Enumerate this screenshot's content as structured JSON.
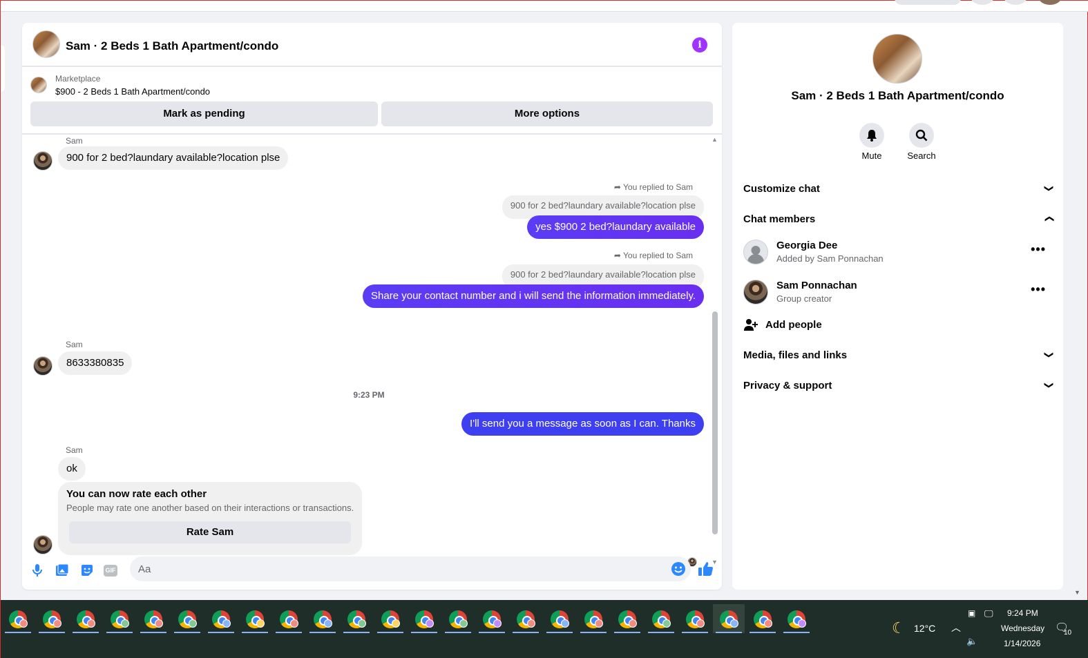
{
  "chat": {
    "title": "Sam · 2 Beds 1 Bath Apartment/condo",
    "info_icon": "info-icon",
    "marketplace_label": "Marketplace",
    "marketplace_item": "$900 - 2 Beds 1 Bath Apartment/condo",
    "mark_pending_label": "Mark as pending",
    "more_options_label": "More options"
  },
  "messages": {
    "m1_sender": "Sam",
    "m1_text": "900 for 2 bed?laundary available?location plse",
    "m2_reply_note": "You replied to Sam",
    "m2_quote": "900 for 2 bed?laundary available?location plse",
    "m2_text": "yes $900 2 bed?laundary available",
    "m3_reply_note": "You replied to Sam",
    "m3_quote": "900 for 2 bed?laundary available?location plse",
    "m3_text": "Share your contact number and i will send the information immediately.",
    "m4_sender": "Sam",
    "m4_text": "8633380835",
    "timestamp": "9:23 PM",
    "m5_text": "I'll send you a message as soon as I can. Thanks",
    "m6_sender": "Sam",
    "m6_text": "ok",
    "rate_title": "You can now rate each other",
    "rate_sub": "People may rate one another based on their interactions or transactions.",
    "rate_button": "Rate Sam"
  },
  "composer": {
    "placeholder": "Aa",
    "icons": [
      "microphone-icon",
      "photo-icon",
      "sticker-icon",
      "gif-icon",
      "emoji-icon",
      "thumbs-up-icon"
    ],
    "gif_label": "GIF"
  },
  "info_panel": {
    "name": "Sam · 2 Beds 1 Bath Apartment/condo",
    "mute_label": "Mute",
    "search_label": "Search",
    "customize_chat": "Customize chat",
    "chat_members": "Chat members",
    "members": [
      {
        "name": "Georgia Dee",
        "sub": "Added by Sam Ponnachan"
      },
      {
        "name": "Sam Ponnachan",
        "sub": "Group creator"
      }
    ],
    "add_people": "Add people",
    "media_files_links": "Media, files and links",
    "privacy_support": "Privacy & support"
  },
  "taskbar": {
    "weather_temp": "12°C",
    "time": "9:24 PM",
    "day": "Wednesday",
    "date": "1/14/2026",
    "notification_count": "10",
    "badge_colors": [
      "#f28b82",
      "#f28b82",
      "#f28b82",
      "#81c995",
      "#f28b82",
      "#81c995",
      "#8ab4f8",
      "#fdd663",
      "#f28b82",
      "#8ab4f8",
      "#81c995",
      "#fdd663",
      "#c58af9",
      "#81c995",
      "#c58af9",
      "#f28b82",
      "#8ab4f8",
      "#f28b82",
      "#f28b82",
      "#81c995",
      "#f28b82",
      "#8ab4f8",
      "#f28b82",
      "#c58af9"
    ]
  }
}
